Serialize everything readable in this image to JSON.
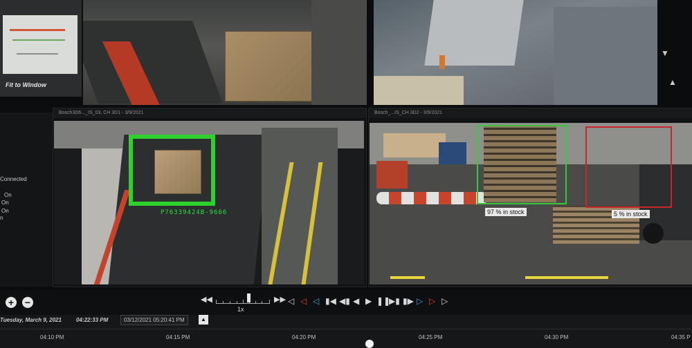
{
  "thumbnail": {
    "label": "Fit to Window"
  },
  "left_panel": {
    "status_lines": [
      "Connected",
      "On",
      "On",
      "On",
      "n"
    ]
  },
  "camera_a": {
    "header": "Bosch3D6..._IS_03, CH 3D1 - 3/9/2021",
    "detection": {
      "color": "#2ed12e",
      "label": "P76339424B-9666"
    }
  },
  "camera_b": {
    "header": "Bosch_...IS_CH 3D2 - 3/9/2021",
    "detections": [
      {
        "color": "#36c93a",
        "label": "97 % in stock"
      },
      {
        "color": "#c8262b",
        "label": "5 % in stock"
      }
    ]
  },
  "playback": {
    "zoom_in": "+",
    "zoom_out": "−",
    "speed": "1x",
    "speed_level": 0.9,
    "rewind_icon": "double-left-arrow",
    "forward_icon": "double-right-arrow"
  },
  "timeline": {
    "current_date": "Tuesday, March 9, 2021",
    "current_time": "04:22:33 PM",
    "jump_date": "03/12/2021 05:20:41 PM",
    "ticks": [
      "04:10 PM",
      "04:15 PM",
      "04:20 PM",
      "04:25 PM",
      "04:30 PM",
      "04:35 P"
    ]
  },
  "colors": {
    "accent_blue": "#3a9fd8",
    "accent_red": "#e0402e"
  }
}
